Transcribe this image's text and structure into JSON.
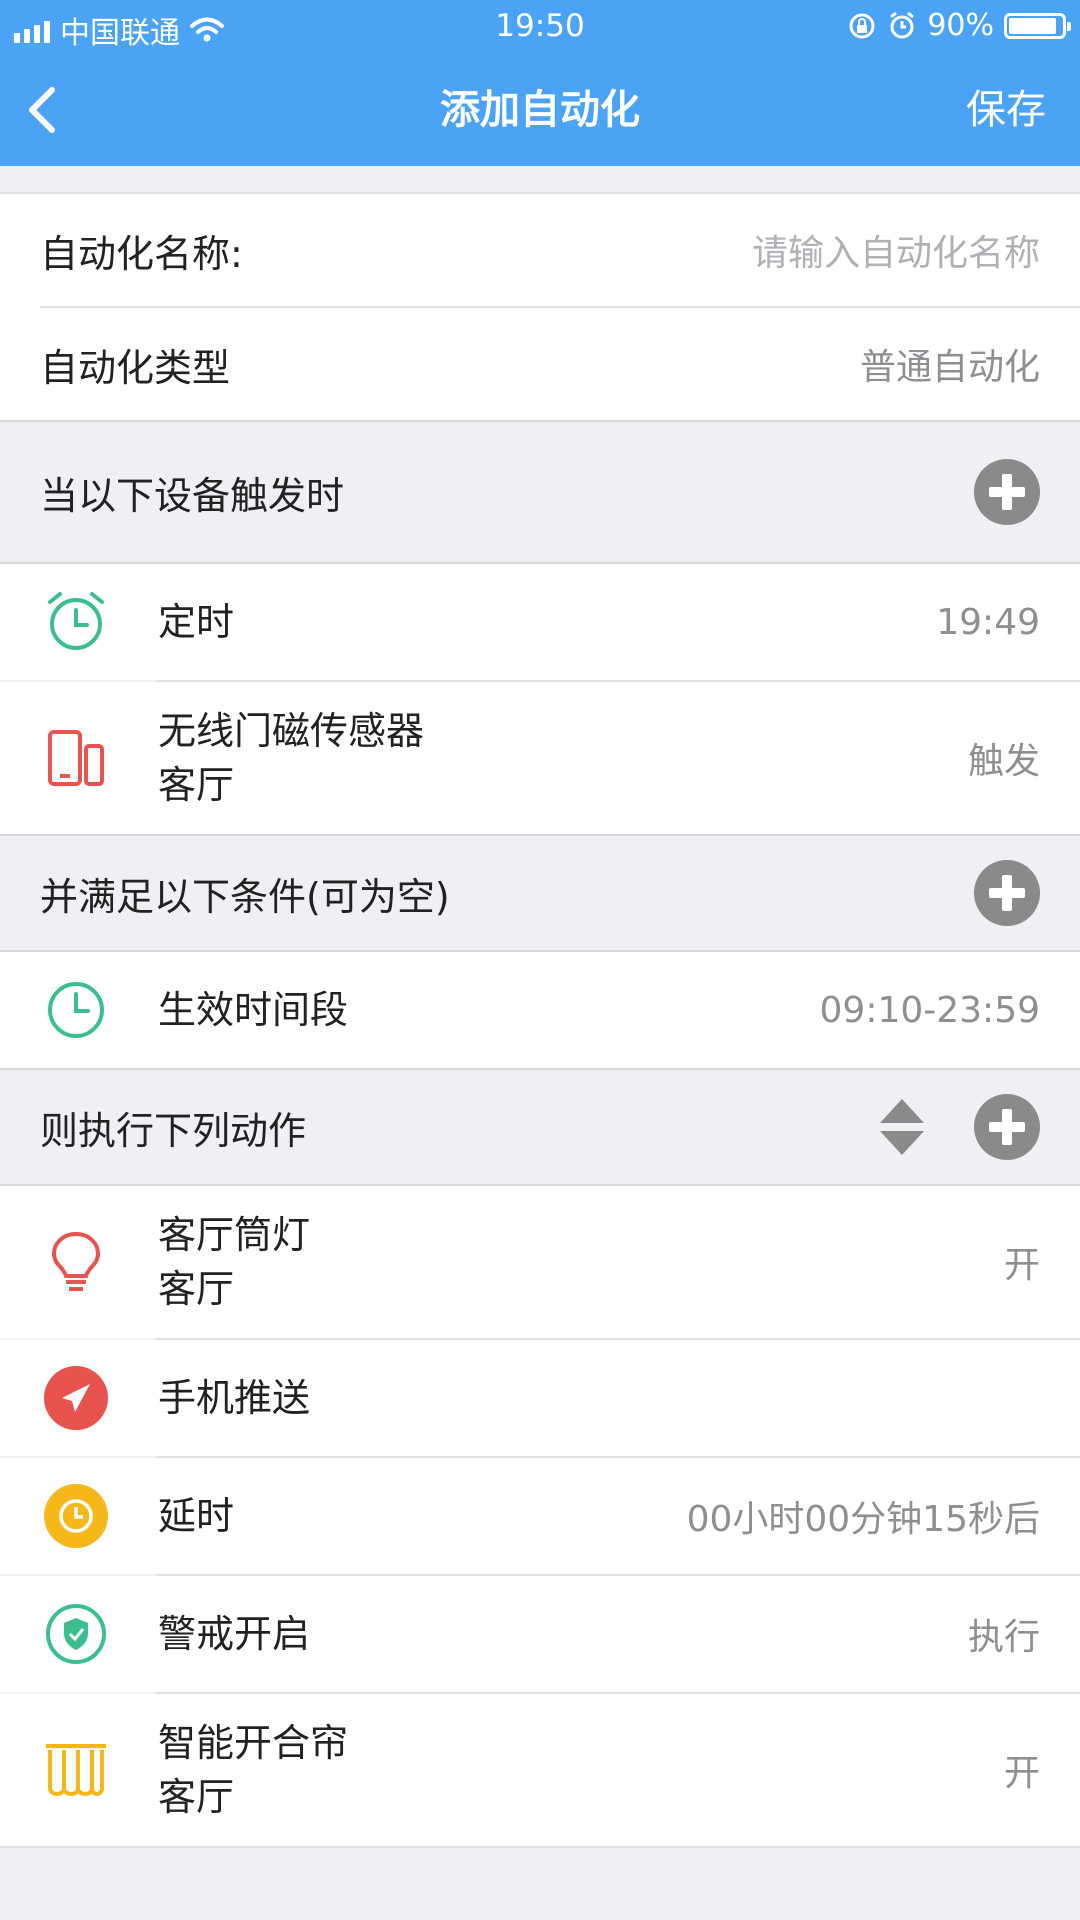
{
  "status_bar": {
    "carrier": "中国联通",
    "time": "19:50",
    "battery_percent": "90%",
    "battery_level": 0.9
  },
  "nav": {
    "title": "添加自动化",
    "save_label": "保存"
  },
  "form": {
    "name_label": "自动化名称:",
    "name_placeholder": "请输入自动化名称",
    "type_label": "自动化类型",
    "type_value": "普通自动化"
  },
  "triggers": {
    "header": "当以下设备触发时",
    "items": [
      {
        "title": "定时",
        "subtitle": "",
        "value": "19:49",
        "icon": "alarm-clock-icon"
      },
      {
        "title": "无线门磁传感器",
        "subtitle": "客厅",
        "value": "触发",
        "icon": "door-sensor-icon"
      }
    ]
  },
  "conditions": {
    "header": "并满足以下条件(可为空)",
    "items": [
      {
        "title": "生效时间段",
        "subtitle": "",
        "value": "09:10-23:59",
        "icon": "clock-icon"
      }
    ]
  },
  "actions": {
    "header": "则执行下列动作",
    "items": [
      {
        "title": "客厅筒灯",
        "subtitle": "客厅",
        "value": "开",
        "icon": "bulb-icon"
      },
      {
        "title": "手机推送",
        "subtitle": "",
        "value": "",
        "icon": "send-icon"
      },
      {
        "title": "延时",
        "subtitle": "",
        "value": "00小时00分钟15秒后",
        "icon": "timer-icon"
      },
      {
        "title": "警戒开启",
        "subtitle": "",
        "value": "执行",
        "icon": "shield-icon"
      },
      {
        "title": "智能开合帘",
        "subtitle": "客厅",
        "value": "开",
        "icon": "curtain-icon"
      }
    ]
  },
  "colors": {
    "primary": "#4aa3f5",
    "green": "#3cbf8f",
    "red": "#e8524f",
    "yellow": "#f5b71a",
    "gray": "#8a8a8a"
  }
}
